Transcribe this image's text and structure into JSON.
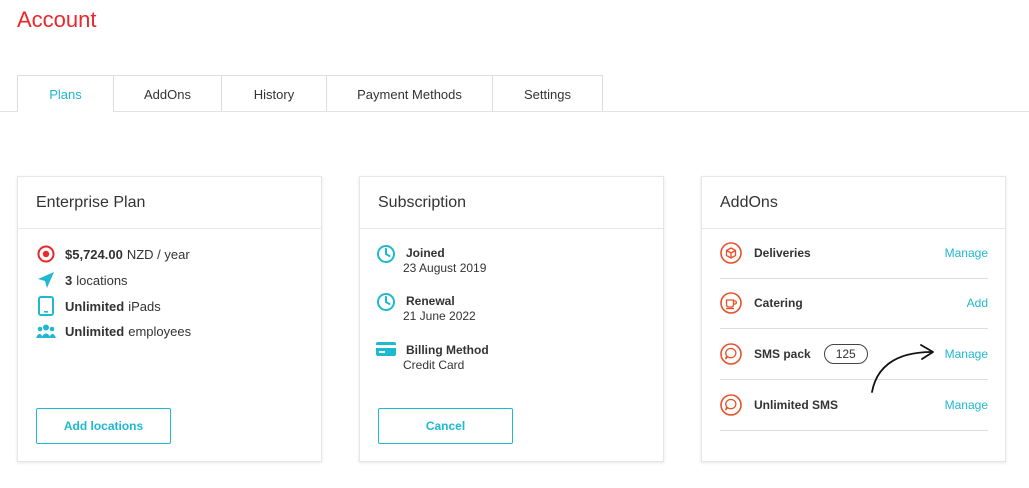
{
  "page": {
    "title": "Account"
  },
  "tabs": [
    {
      "label": "Plans",
      "active": true
    },
    {
      "label": "AddOns"
    },
    {
      "label": "History"
    },
    {
      "label": "Payment Methods"
    },
    {
      "label": "Settings"
    }
  ],
  "plan_card": {
    "title": "Enterprise Plan",
    "items": [
      {
        "icon": "price-target-icon",
        "bold": "$5,724.00",
        "text": "NZD / year"
      },
      {
        "icon": "location-arrow-icon",
        "bold": "3",
        "text": "locations"
      },
      {
        "icon": "tablet-icon",
        "bold": "Unlimited",
        "text": "iPads"
      },
      {
        "icon": "people-icon",
        "bold": "Unlimited",
        "text": "employees"
      }
    ],
    "button_label": "Add locations"
  },
  "subscription_card": {
    "title": "Subscription",
    "items": [
      {
        "icon": "clock-icon",
        "label": "Joined",
        "value": "23 August 2019"
      },
      {
        "icon": "clock-icon",
        "label": "Renewal",
        "value": "21 June 2022"
      },
      {
        "icon": "credit-card-icon",
        "label": "Billing Method",
        "value": "Credit Card"
      }
    ],
    "button_label": "Cancel"
  },
  "addons_card": {
    "title": "AddOns",
    "items": [
      {
        "icon": "box-icon",
        "name": "Deliveries",
        "action": "Manage"
      },
      {
        "icon": "coffee-cup-icon",
        "name": "Catering",
        "action": "Add"
      },
      {
        "icon": "chat-bubble-icon",
        "name": "SMS pack",
        "count": "125",
        "action": "Manage"
      },
      {
        "icon": "chat-bubble-icon",
        "name": "Unlimited SMS",
        "action": "Manage"
      }
    ]
  },
  "colors": {
    "brand_red": "#e8282b",
    "accent_cyan": "#1fb8d1",
    "addon_orange": "#e8502a"
  }
}
